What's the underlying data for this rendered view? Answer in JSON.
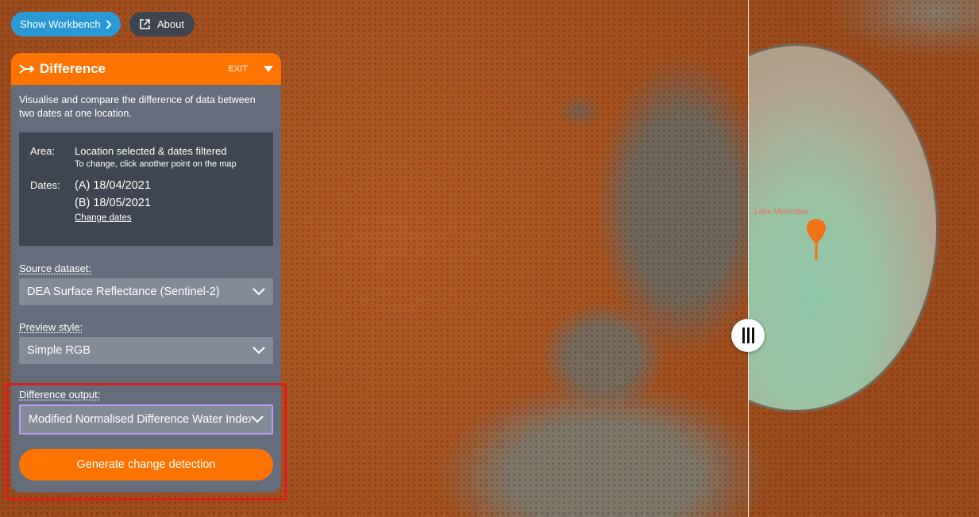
{
  "top": {
    "workbench_label": "Show Workbench",
    "about_label": "About"
  },
  "panel": {
    "title": "Difference",
    "exit_label": "EXIT",
    "description": "Visualise and compare the difference of data between two dates at one location.",
    "area_label": "Area:",
    "area_value": "Location selected & dates filtered",
    "area_hint": "To change, click another point on the map",
    "dates_label": "Dates:",
    "date_a": "(A) 18/04/2021",
    "date_b": "(B) 18/05/2021",
    "change_dates": "Change dates",
    "source_label": "Source dataset:",
    "source_value": "DEA Surface Reflectance (Sentinel-2)",
    "preview_label": "Preview style:",
    "preview_value": "Simple RGB",
    "output_label": "Difference output:",
    "output_value": "Modified Normalised Difference Water Index",
    "generate_label": "Generate change detection"
  },
  "map": {
    "place_label": "Lake Menindee"
  },
  "colors": {
    "accent": "#ff7300",
    "workbench": "#2a9ad6",
    "panel": "#656d7c",
    "highlight": "#e01b1b"
  }
}
